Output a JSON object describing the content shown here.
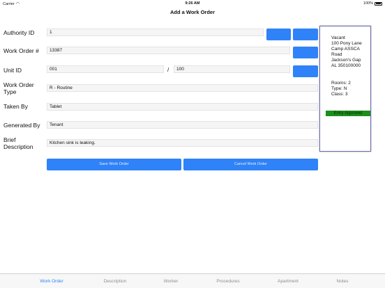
{
  "status_bar": {
    "carrier": "Carrier",
    "time": "9:26 AM",
    "battery": "100%"
  },
  "nav": {
    "title": "Add a Work Order"
  },
  "form": {
    "authority_id": {
      "label": "Authority ID",
      "value": "1"
    },
    "work_order_number": {
      "label": "Work Order #",
      "value": "13387"
    },
    "unit_id": {
      "label": "Unit ID",
      "value": "001",
      "separator": "/",
      "value2": "100"
    },
    "work_order_type": {
      "label": "Work Order Type",
      "value": "R - Routine"
    },
    "taken_by": {
      "label": "Taken By",
      "value": "Tablet"
    },
    "generated_by": {
      "label": "Generated By",
      "value": "Tenant"
    },
    "brief_description": {
      "label": "Brief Description",
      "value": "Kitchen sink is leaking."
    }
  },
  "actions": {
    "save_label": "Save Work Order",
    "cancel_label": "Cancel Work Order"
  },
  "unit_info": {
    "lines": [
      "Vacant",
      "100 Pony Lane",
      "Camp ASSCA",
      "Road",
      "Jackson's Gap",
      "AL 350100000"
    ],
    "rooms": "Rooms: 2",
    "type": "Type:  N",
    "class": "Class: 3",
    "status_badge": "Entry Approved"
  },
  "tabs": [
    {
      "label": "Work Order",
      "active": true
    },
    {
      "label": "Description",
      "active": false
    },
    {
      "label": "Worker",
      "active": false
    },
    {
      "label": "Procedures",
      "active": false
    },
    {
      "label": "Apartment",
      "active": false
    },
    {
      "label": "Notes",
      "active": false
    }
  ],
  "colors": {
    "accent": "#2f82f7",
    "badge": "#1a8f1a",
    "panel_border": "#6b6bb8"
  }
}
